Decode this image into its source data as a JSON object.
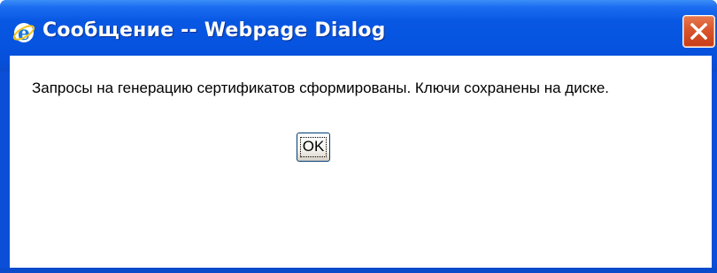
{
  "window": {
    "title": "Сообщение -- Webpage Dialog",
    "title_icon": "internet-explorer-icon",
    "close_icon": "close-icon"
  },
  "dialog": {
    "message": "Запросы на генерацию сертификатов сформированы. Ключи сохранены на диске.",
    "ok_label": "OK"
  },
  "colors": {
    "titlebar": "#0654e0",
    "close_button": "#d9552c",
    "client_background": "#ffffff"
  }
}
